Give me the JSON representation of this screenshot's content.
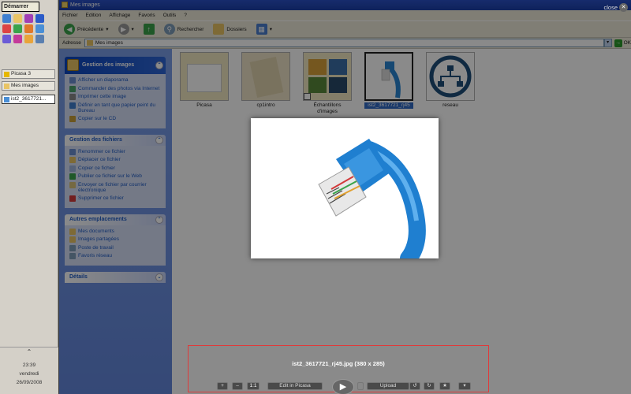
{
  "taskbar": {
    "start_label": "Démarrer",
    "tasks": [
      {
        "label": "Picasa 3",
        "color": "#e6b800"
      },
      {
        "label": "Mes images",
        "color": "#e9c464"
      },
      {
        "label": "ist2_3617721...",
        "color": "#4a8fd6"
      }
    ],
    "tray": {
      "time": "23:39",
      "day": "vendredi",
      "date": "26/09/2008"
    }
  },
  "window": {
    "title": "Mes images",
    "menu": [
      "Fichier",
      "Edition",
      "Affichage",
      "Favoris",
      "Outils",
      "?"
    ],
    "toolbar": {
      "back": "Précédente",
      "search": "Rechercher",
      "folders": "Dossiers"
    },
    "address": {
      "label": "Adresse",
      "value": "Mes images",
      "go": "OK"
    }
  },
  "taskpane": {
    "image_tasks": {
      "title": "Gestion des images",
      "items": [
        {
          "label": "Afficher un diaporama",
          "icon": "slideshow-icon",
          "color": "#6b8fd1"
        },
        {
          "label": "Commander des photos via Internet",
          "icon": "order-photos-icon",
          "color": "#4aa36b"
        },
        {
          "label": "Imprimer cette image",
          "icon": "print-icon",
          "color": "#8a8a8a"
        },
        {
          "label": "Définir en tant que papier peint du Bureau",
          "icon": "wallpaper-icon",
          "color": "#3f7fd0"
        },
        {
          "label": "Copier sur le CD",
          "icon": "cd-icon",
          "color": "#c7a03a"
        }
      ]
    },
    "file_tasks": {
      "title": "Gestion des fichiers",
      "items": [
        {
          "label": "Renommer ce fichier",
          "icon": "rename-icon",
          "color": "#6b8fd1"
        },
        {
          "label": "Déplacer ce fichier",
          "icon": "move-icon",
          "color": "#e9c464"
        },
        {
          "label": "Copier ce fichier",
          "icon": "copy-icon",
          "color": "#9fb5e0"
        },
        {
          "label": "Publier ce fichier sur le Web",
          "icon": "publish-web-icon",
          "color": "#3aa34a"
        },
        {
          "label": "Envoyer ce fichier par courrier électronique",
          "icon": "email-icon",
          "color": "#d9c27a"
        },
        {
          "label": "Supprimer ce fichier",
          "icon": "delete-icon",
          "color": "#d23a3a"
        }
      ]
    },
    "other_places": {
      "title": "Autres emplacements",
      "items": [
        {
          "label": "Mes documents",
          "icon": "documents-icon",
          "color": "#e9c464"
        },
        {
          "label": "Images partagées",
          "icon": "shared-images-icon",
          "color": "#e9c464"
        },
        {
          "label": "Poste de travail",
          "icon": "computer-icon",
          "color": "#7f9db9"
        },
        {
          "label": "Favoris réseau",
          "icon": "network-icon",
          "color": "#7f9db9"
        }
      ]
    },
    "details": {
      "title": "Détails"
    }
  },
  "files": [
    {
      "label": "Picasa"
    },
    {
      "label": "cp1intro"
    },
    {
      "label": "Échantillons d'images"
    },
    {
      "label": "ist2_3617721_rj45",
      "selected": true
    },
    {
      "label": "reseau"
    }
  ],
  "viewer": {
    "close_label": "close",
    "caption": "ist2_3617721_rj45.jpg (380 x 285)",
    "controls": {
      "zoom_in": "+",
      "zoom_out": "–",
      "actual_size": "1:1",
      "edit": "Edit in Picasa",
      "upload": "Upload"
    }
  }
}
